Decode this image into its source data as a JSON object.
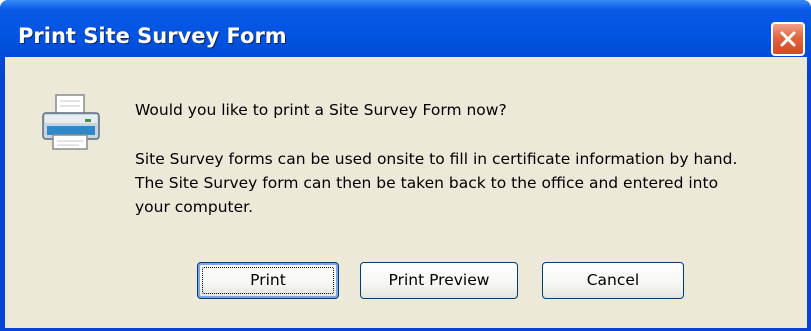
{
  "window": {
    "title": "Print Site Survey Form"
  },
  "dialog": {
    "icon": "printer-icon",
    "question": "Would you like to print a Site Survey Form now?",
    "body": "Site Survey forms can be used onsite to fill in certificate information by hand. The Site Survey form can then be taken back to the office and entered into your computer."
  },
  "buttons": {
    "print": "Print",
    "print_preview": "Print Preview",
    "cancel": "Cancel"
  },
  "colors": {
    "titlebar": "#0054e3",
    "client": "#ece9d8",
    "close": "#e2653f"
  }
}
